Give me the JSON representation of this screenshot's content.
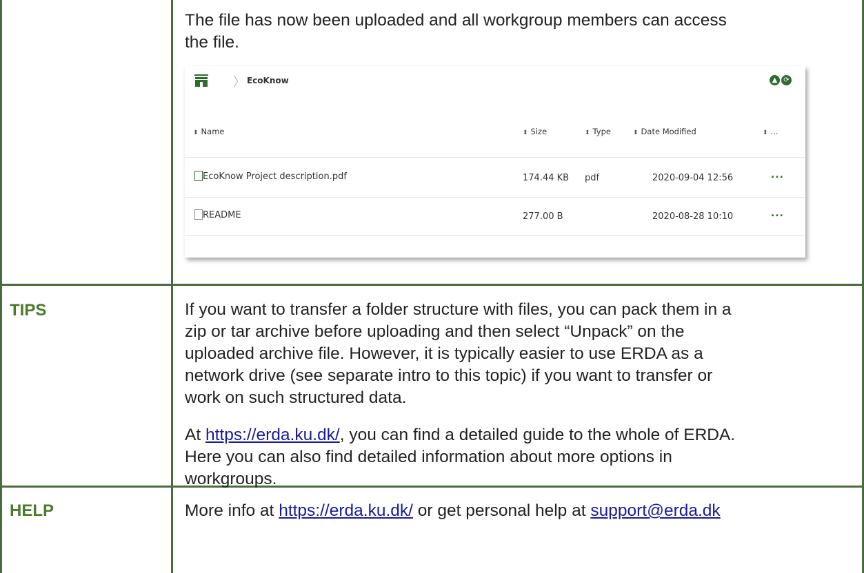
{
  "row1": {
    "text_line1": "The file has now been uploaded and all workgroup members can access",
    "text_line2": "the file."
  },
  "panel": {
    "breadcrumb": "EcoKnow",
    "columns": {
      "name": "Name",
      "size": "Size",
      "type": "Type",
      "date": "Date Modified",
      "more": "..."
    },
    "files": [
      {
        "name": "EcoKnow Project description.pdf",
        "size": "174.44 KB",
        "type": "pdf",
        "date": "2020-09-04 12:56",
        "more": "..."
      },
      {
        "name": "README",
        "size": "277.00 B",
        "type": "",
        "date": "2020-08-28 10:10",
        "more": "..."
      }
    ],
    "icons": [
      "home-icon",
      "upload-icon",
      "refresh-icon",
      "pdf-file-icon",
      "file-icon"
    ]
  },
  "tips": {
    "label": "TIPS",
    "para1": [
      "If you want to transfer a folder structure with files, you can pack them in a",
      "zip or tar archive before uploading and then select “Unpack” on the",
      "uploaded archive file. However, it is typically easier to use ERDA as a",
      "network drive (see separate intro to this topic) if you want to transfer or",
      "work on such structured data."
    ],
    "para2_prefix": "At ",
    "para2_link": "https://erda.ku.dk/",
    "para2_rest_line1": ", you can find a detailed guide to the whole of ERDA.",
    "para2_line2": "Here you can also find detailed information about more options in",
    "para2_line3": "workgroups."
  },
  "help": {
    "label": "HELP",
    "prefix": "More info at ",
    "link1": "https://erda.ku.dk/",
    "middle": " or get personal help at ",
    "link2": "support@erda.dk"
  },
  "colors": {
    "border": "#4a6b3a",
    "label": "#4a7a2c",
    "link": "#1a1a9a"
  }
}
